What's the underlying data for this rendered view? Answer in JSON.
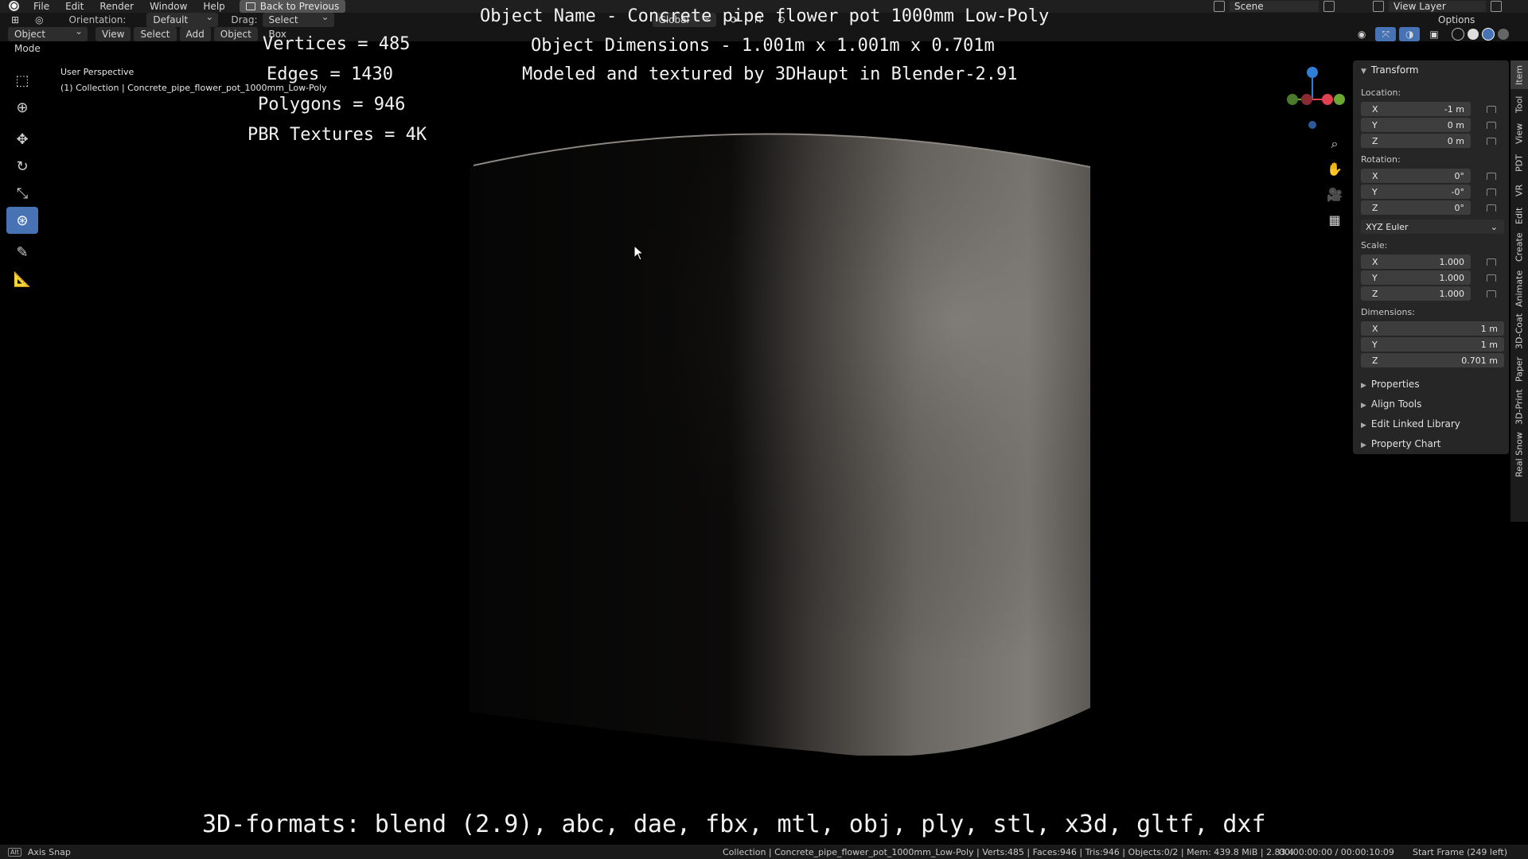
{
  "topbar": {
    "menus": [
      "File",
      "Edit",
      "Render",
      "Window",
      "Help"
    ],
    "back_label": "Back to Previous",
    "scene": "Scene",
    "view_layer": "View Layer"
  },
  "header": {
    "orientation_label": "Orientation:",
    "orientation_value": "Default",
    "drag_label": "Drag:",
    "drag_value": "Select Box",
    "transform_orientation": "Global",
    "options": "Options",
    "mode": "Object Mode",
    "menus": [
      "View",
      "Select",
      "Add",
      "Object"
    ]
  },
  "viewport": {
    "perspective": "User Perspective",
    "collection": "(1) Collection | Concrete_pipe_flower_pot_1000mm_Low-Poly"
  },
  "overlay": {
    "object_name": "Object Name - Concrete pipe flower pot 1000mm Low-Poly",
    "object_dimensions": "Object Dimensions -  1.001m x 1.001m x 0.701m",
    "credit": "Modeled and textured by 3DHaupt in Blender-2.91",
    "vertices": "Vertices = 485",
    "edges": "Edges = 1430",
    "polygons": "Polygons = 946",
    "textures": "PBR Textures = 4K",
    "formats": "3D-formats: blend (2.9), abc, dae, fbx, mtl, obj, ply, stl, x3d, gltf, dxf"
  },
  "npanel": {
    "transform_title": "Transform",
    "location_label": "Location:",
    "location": [
      {
        "axis": "X",
        "value": "-1 m"
      },
      {
        "axis": "Y",
        "value": "0 m"
      },
      {
        "axis": "Z",
        "value": "0 m"
      }
    ],
    "rotation_label": "Rotation:",
    "rotation": [
      {
        "axis": "X",
        "value": "0°"
      },
      {
        "axis": "Y",
        "value": "-0°"
      },
      {
        "axis": "Z",
        "value": "0°"
      }
    ],
    "rotation_mode": "XYZ Euler",
    "scale_label": "Scale:",
    "scale": [
      {
        "axis": "X",
        "value": "1.000"
      },
      {
        "axis": "Y",
        "value": "1.000"
      },
      {
        "axis": "Z",
        "value": "1.000"
      }
    ],
    "dimensions_label": "Dimensions:",
    "dimensions": [
      {
        "axis": "X",
        "value": "1 m"
      },
      {
        "axis": "Y",
        "value": "1 m"
      },
      {
        "axis": "Z",
        "value": "0.701 m"
      }
    ],
    "collapsed": [
      "Properties",
      "Align Tools",
      "Edit Linked Library",
      "Property Chart"
    ]
  },
  "vtabs": [
    "Item",
    "Tool",
    "View",
    "PDT",
    "VR",
    "Edit",
    "Create",
    "Animate",
    "3D-Coat",
    "Paper",
    "3D-Print",
    "Real Snow"
  ],
  "statusbar": {
    "left": "Axis Snap",
    "info": "Collection | Concrete_pipe_flower_pot_1000mm_Low-Poly | Verts:485 | Faces:946 | Tris:946 | Objects:0/2 | Mem: 439.8 MiB | 2.83.4",
    "time": "00:00:00:00 / 00:00:10:09",
    "frame": "Start Frame (249 left)"
  },
  "colors": {
    "accent": "#4772b3",
    "axis_x": "#e0404f",
    "axis_y": "#6ca832",
    "axis_z": "#2f7fd6"
  }
}
